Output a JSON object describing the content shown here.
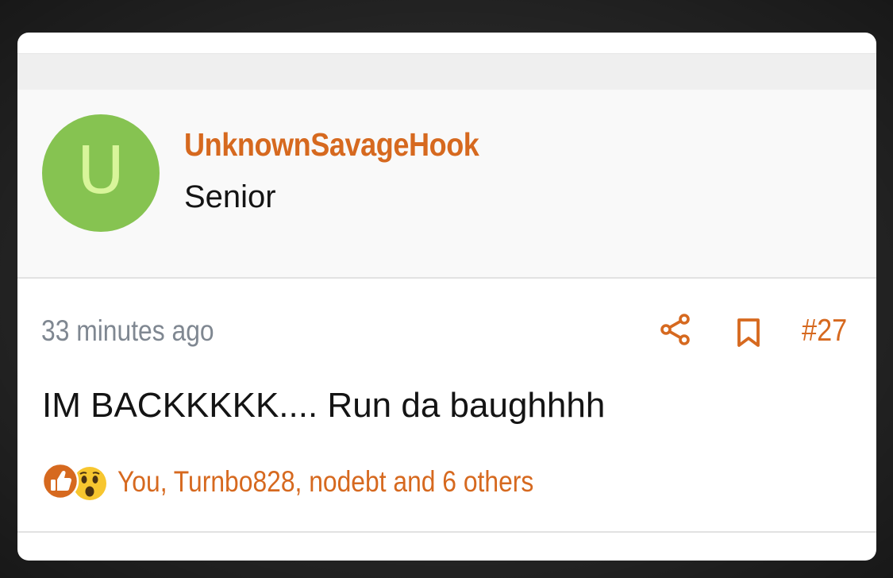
{
  "user": {
    "avatar_letter": "U",
    "username": "UnknownSavageHook",
    "title": "Senior"
  },
  "post": {
    "timestamp": "33 minutes ago",
    "number": "#27",
    "message": "IM BACKKKKK.... Run da baughhhh",
    "reactions_text": "You, Turnbo828, nodebt and 6 others"
  },
  "icons": {
    "share": "share-icon",
    "bookmark": "bookmark-icon",
    "like": "like-reaction-icon",
    "wow": "wow-reaction-icon"
  },
  "colors": {
    "accent": "#d6691f",
    "avatar_bg": "#86c351",
    "avatar_letter": "#d8f59a",
    "muted_text": "#7f8791",
    "text": "#141414"
  }
}
